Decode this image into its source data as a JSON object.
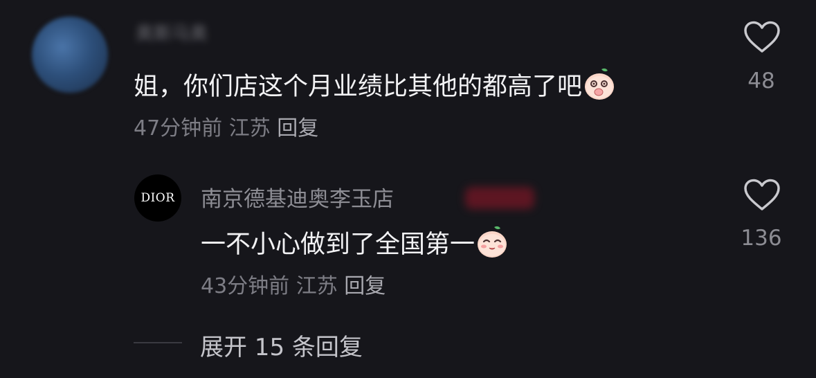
{
  "comment": {
    "username": "奥斯马奥",
    "text": "姐，你们店这个月业绩比其他的都高了吧",
    "emoji": "peach-covering-mouth-emoji",
    "time": "47分钟前",
    "location": "江苏",
    "reply_label": "回复",
    "likes": "48"
  },
  "reply": {
    "avatar_text": "DIOR",
    "username": "南京德基迪奥李玉店",
    "text": "一不小心做到了全国第一",
    "emoji": "peach-smiling-emoji",
    "time": "43分钟前",
    "location": "江苏",
    "reply_label": "回复",
    "likes": "136"
  },
  "expand_label": "展开 15 条回复",
  "colors": {
    "background": "#16161b",
    "text_primary": "#f2f2f4",
    "text_secondary": "#7d7d85"
  }
}
